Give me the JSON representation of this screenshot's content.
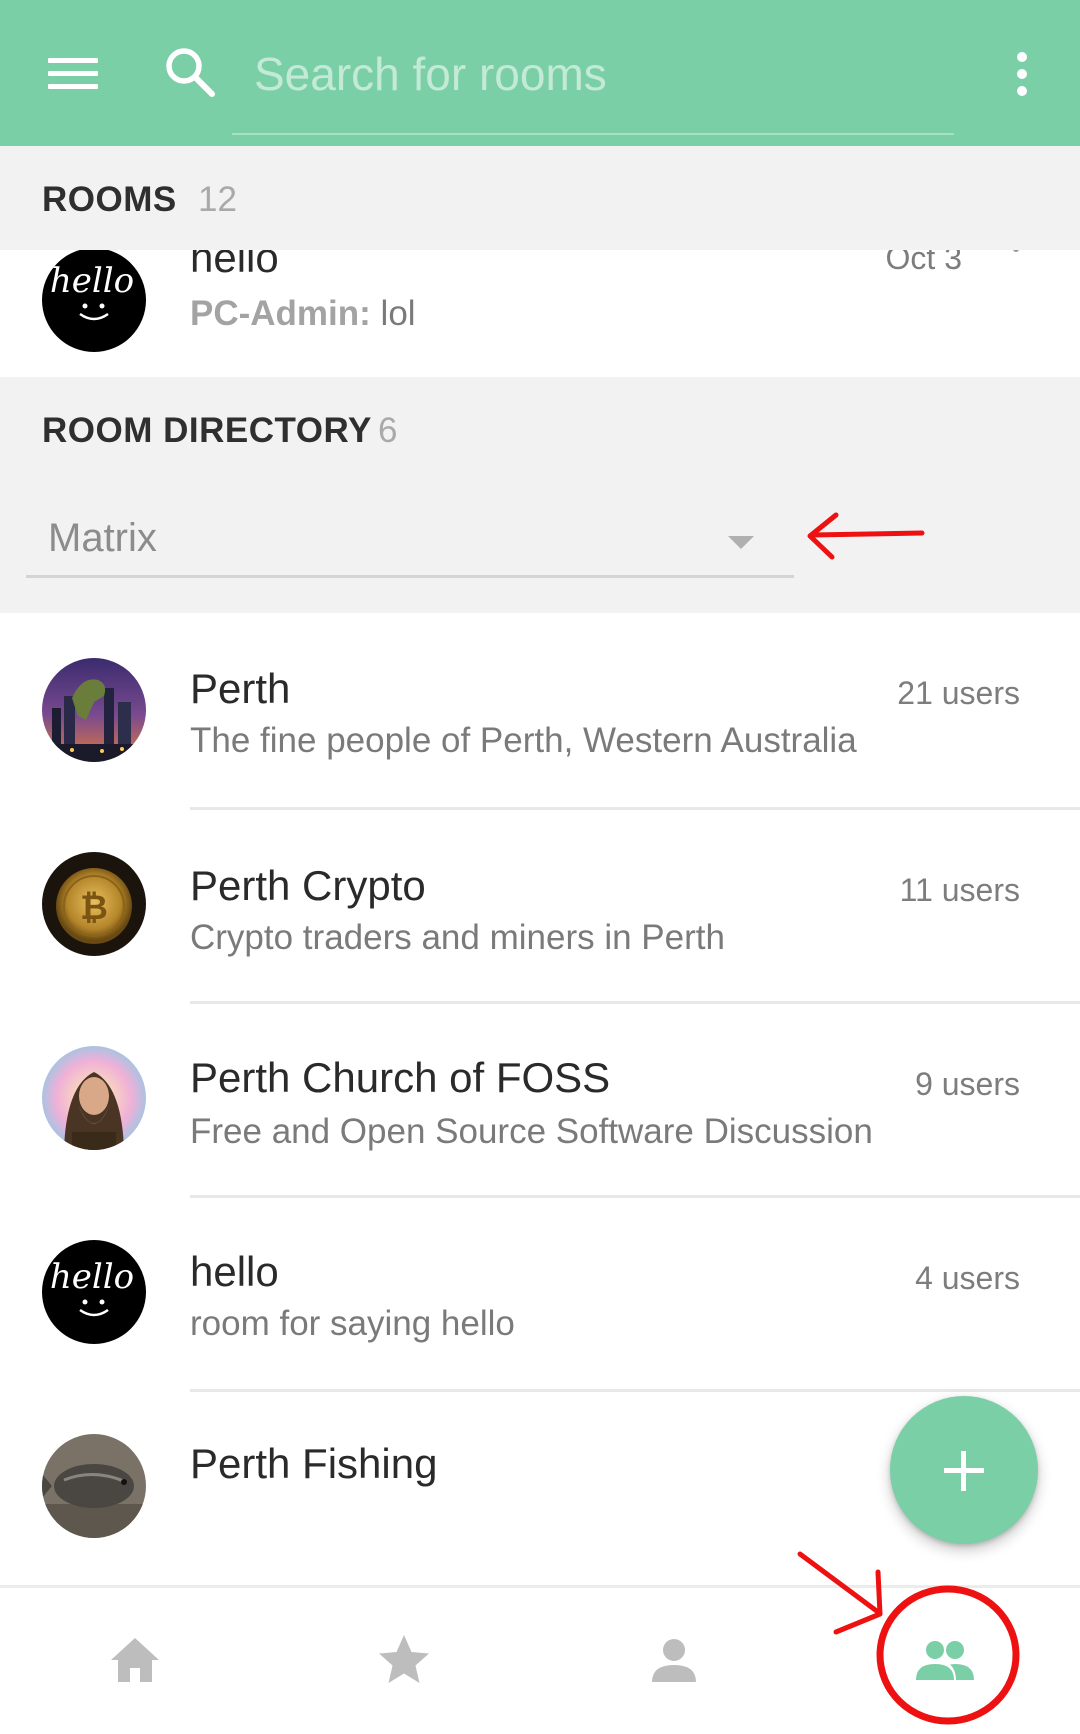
{
  "app_bar": {
    "search_placeholder": "Search for rooms",
    "accent_color": "#7acfa6"
  },
  "rooms_section": {
    "title": "ROOMS",
    "count": "12",
    "partial_item": {
      "name": "hello",
      "date": "Oct 3",
      "last_sender": "PC-Admin:",
      "last_message": "lol",
      "avatar_text": "hello"
    }
  },
  "directory_section": {
    "title": "ROOM DIRECTORY",
    "count": "6",
    "server_select": "Matrix"
  },
  "directory_rooms": [
    {
      "name": "Perth",
      "users": "21 users",
      "topic": "The fine people of Perth, Western Australia"
    },
    {
      "name": "Perth Crypto",
      "users": "11 users",
      "topic": "Crypto traders and miners in Perth"
    },
    {
      "name": "Perth Church of FOSS",
      "users": "9 users",
      "topic": "Free and Open Source Software Discussion"
    },
    {
      "name": "hello",
      "users": "4 users",
      "topic": "room for saying hello",
      "avatar_text": "hello"
    },
    {
      "name": "Perth Fishing",
      "users": "",
      "topic": ""
    }
  ],
  "bottom_nav": {
    "items": [
      "home-icon",
      "star-icon",
      "person-icon",
      "people-icon"
    ],
    "active": "people-icon"
  },
  "fab": {
    "icon": "plus-icon"
  },
  "annotation_color": "#ee1111"
}
